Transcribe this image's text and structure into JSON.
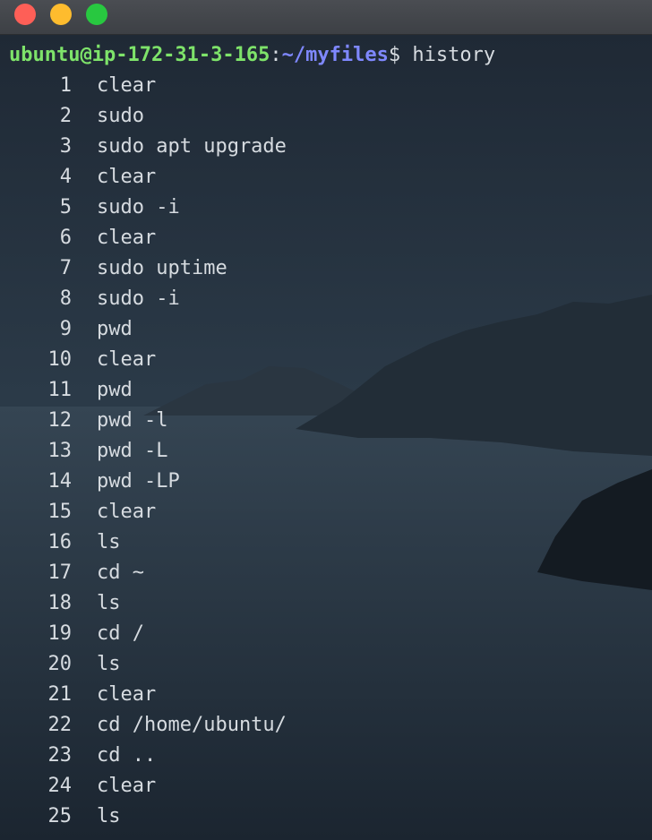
{
  "window": {
    "buttons": [
      "close",
      "minimize",
      "maximize"
    ]
  },
  "prompt": {
    "user_host": "ubuntu@ip-172-31-3-165",
    "colon": ":",
    "path": "~/myfiles",
    "symbol": "$ ",
    "command": "history"
  },
  "history": [
    {
      "num": "1",
      "cmd": "clear"
    },
    {
      "num": "2",
      "cmd": "sudo"
    },
    {
      "num": "3",
      "cmd": "sudo apt upgrade"
    },
    {
      "num": "4",
      "cmd": "clear"
    },
    {
      "num": "5",
      "cmd": "sudo -i"
    },
    {
      "num": "6",
      "cmd": "clear"
    },
    {
      "num": "7",
      "cmd": "sudo uptime"
    },
    {
      "num": "8",
      "cmd": "sudo -i"
    },
    {
      "num": "9",
      "cmd": "pwd"
    },
    {
      "num": "10",
      "cmd": "clear"
    },
    {
      "num": "11",
      "cmd": "pwd"
    },
    {
      "num": "12",
      "cmd": "pwd -l"
    },
    {
      "num": "13",
      "cmd": "pwd -L"
    },
    {
      "num": "14",
      "cmd": "pwd -LP"
    },
    {
      "num": "15",
      "cmd": "clear"
    },
    {
      "num": "16",
      "cmd": "ls"
    },
    {
      "num": "17",
      "cmd": "cd ~"
    },
    {
      "num": "18",
      "cmd": "ls"
    },
    {
      "num": "19",
      "cmd": "cd /"
    },
    {
      "num": "20",
      "cmd": "ls"
    },
    {
      "num": "21",
      "cmd": "clear"
    },
    {
      "num": "22",
      "cmd": "cd /home/ubuntu/"
    },
    {
      "num": "23",
      "cmd": "cd .."
    },
    {
      "num": "24",
      "cmd": "clear"
    },
    {
      "num": "25",
      "cmd": "ls"
    }
  ],
  "colors": {
    "user_host": "#7ee36a",
    "path": "#7f88ff",
    "text": "#d6dbe0"
  }
}
